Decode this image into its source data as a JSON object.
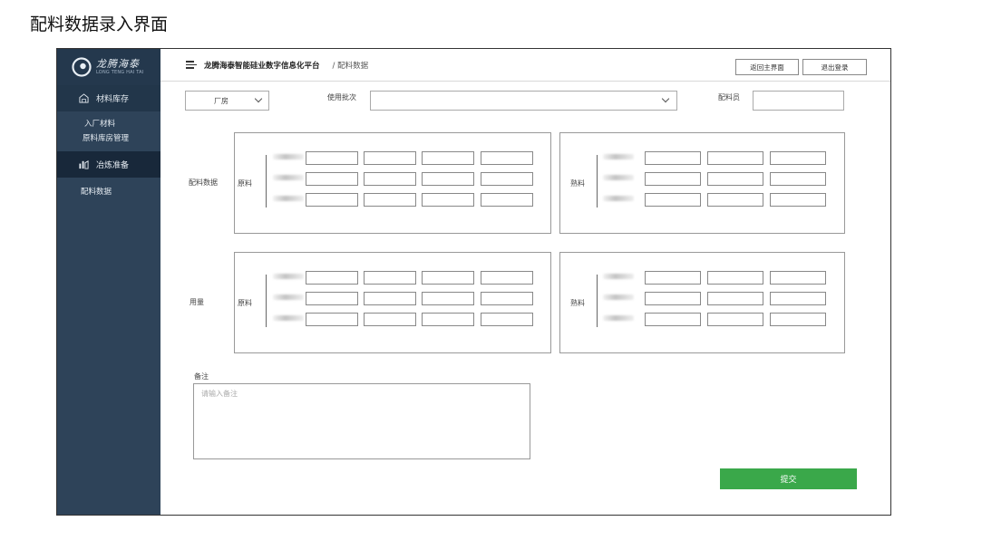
{
  "page_title": "配料数据录入界面",
  "logo": {
    "cn": "龙腾海泰",
    "en": "LONG TENG HAI TAI"
  },
  "sidebar": {
    "groups": [
      {
        "label": "材料库存",
        "icon": "warehouse-icon",
        "items": [
          "入厂材料",
          "原料库房管理"
        ]
      },
      {
        "label": "冶炼准备",
        "icon": "smelting-icon",
        "items": [
          "配料数据"
        ]
      }
    ]
  },
  "header": {
    "platform": "龙腾海泰智能硅业数字信息化平台",
    "breadcrumb": "/ 配料数据",
    "back_label": "返回主界面",
    "logout_label": "退出登录"
  },
  "form": {
    "factory_value": "厂房",
    "batch_label": "使用批次",
    "batch_value": "",
    "operator_label": "配料员",
    "operator_value": ""
  },
  "sections": [
    {
      "label": "配料数据",
      "raw_label": "原料",
      "cooked_label": "熟料"
    },
    {
      "label": "用量",
      "raw_label": "原料",
      "cooked_label": "熟料"
    }
  ],
  "remark": {
    "label": "备注",
    "placeholder": "请输入备注",
    "value": ""
  },
  "submit_label": "提交",
  "colors": {
    "sidebar": "#2e4359",
    "sidebar_active": "#18283a",
    "submit": "#3aa84a"
  }
}
